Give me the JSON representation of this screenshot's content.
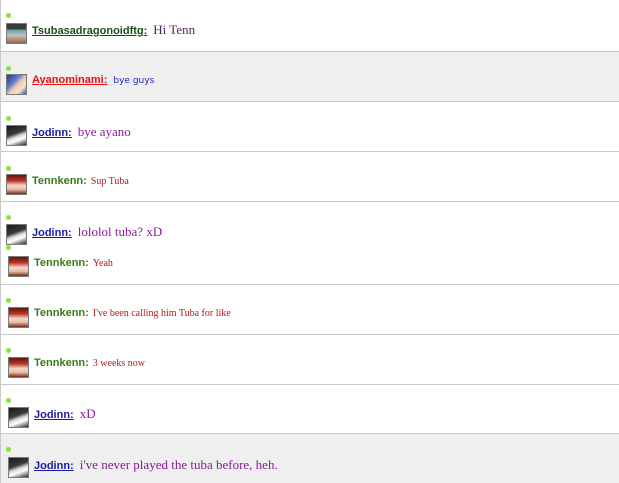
{
  "colors": {
    "tsuba_name": "#1a4d1a",
    "ayano_name": "#e81010",
    "jodinn_name": "#1a1aaa",
    "tenn_name": "#3a7a1a",
    "tsuba_text": "#4a2a5a",
    "ayano_text": "#2020d0",
    "jodinn_text": "#8a1a9a",
    "tenn_text": "#b01a1a",
    "online_dot": "#8ee03f",
    "row_shade": "#efefef",
    "border": "#c9c9c9"
  },
  "messages": [
    {
      "user": "Tsubasadragonoidftg:",
      "text": "Hi  Tenn",
      "avatar": "dragon-avatar-icon"
    },
    {
      "user": "Ayanominami:",
      "text": "bye guys",
      "avatar": "anime-girl-avatar-icon"
    },
    {
      "user": "Jodinn:",
      "text": "bye ayano",
      "avatar": "dark-hair-avatar-icon"
    },
    {
      "user": "Tennkenn:",
      "text": "Sup Tuba",
      "avatar": "red-anime-avatar-icon"
    },
    {
      "user": "Jodinn:",
      "text": "lololol tuba? xD",
      "avatar": "dark-hair-avatar-icon"
    },
    {
      "user": "Tennkenn:",
      "text": "Yeah",
      "avatar": "red-anime-avatar-icon"
    },
    {
      "user": "Tennkenn:",
      "text": "I've been calling him Tuba for like",
      "avatar": "red-anime-avatar-icon"
    },
    {
      "user": "Tennkenn:",
      "text": "3 weeks now",
      "avatar": "red-anime-avatar-icon"
    },
    {
      "user": "Jodinn:",
      "text": "xD",
      "avatar": "dark-hair-avatar-icon"
    },
    {
      "user": "Jodinn:",
      "text": "i've never played the tuba before, heh.",
      "avatar": "dark-hair-avatar-icon"
    }
  ]
}
